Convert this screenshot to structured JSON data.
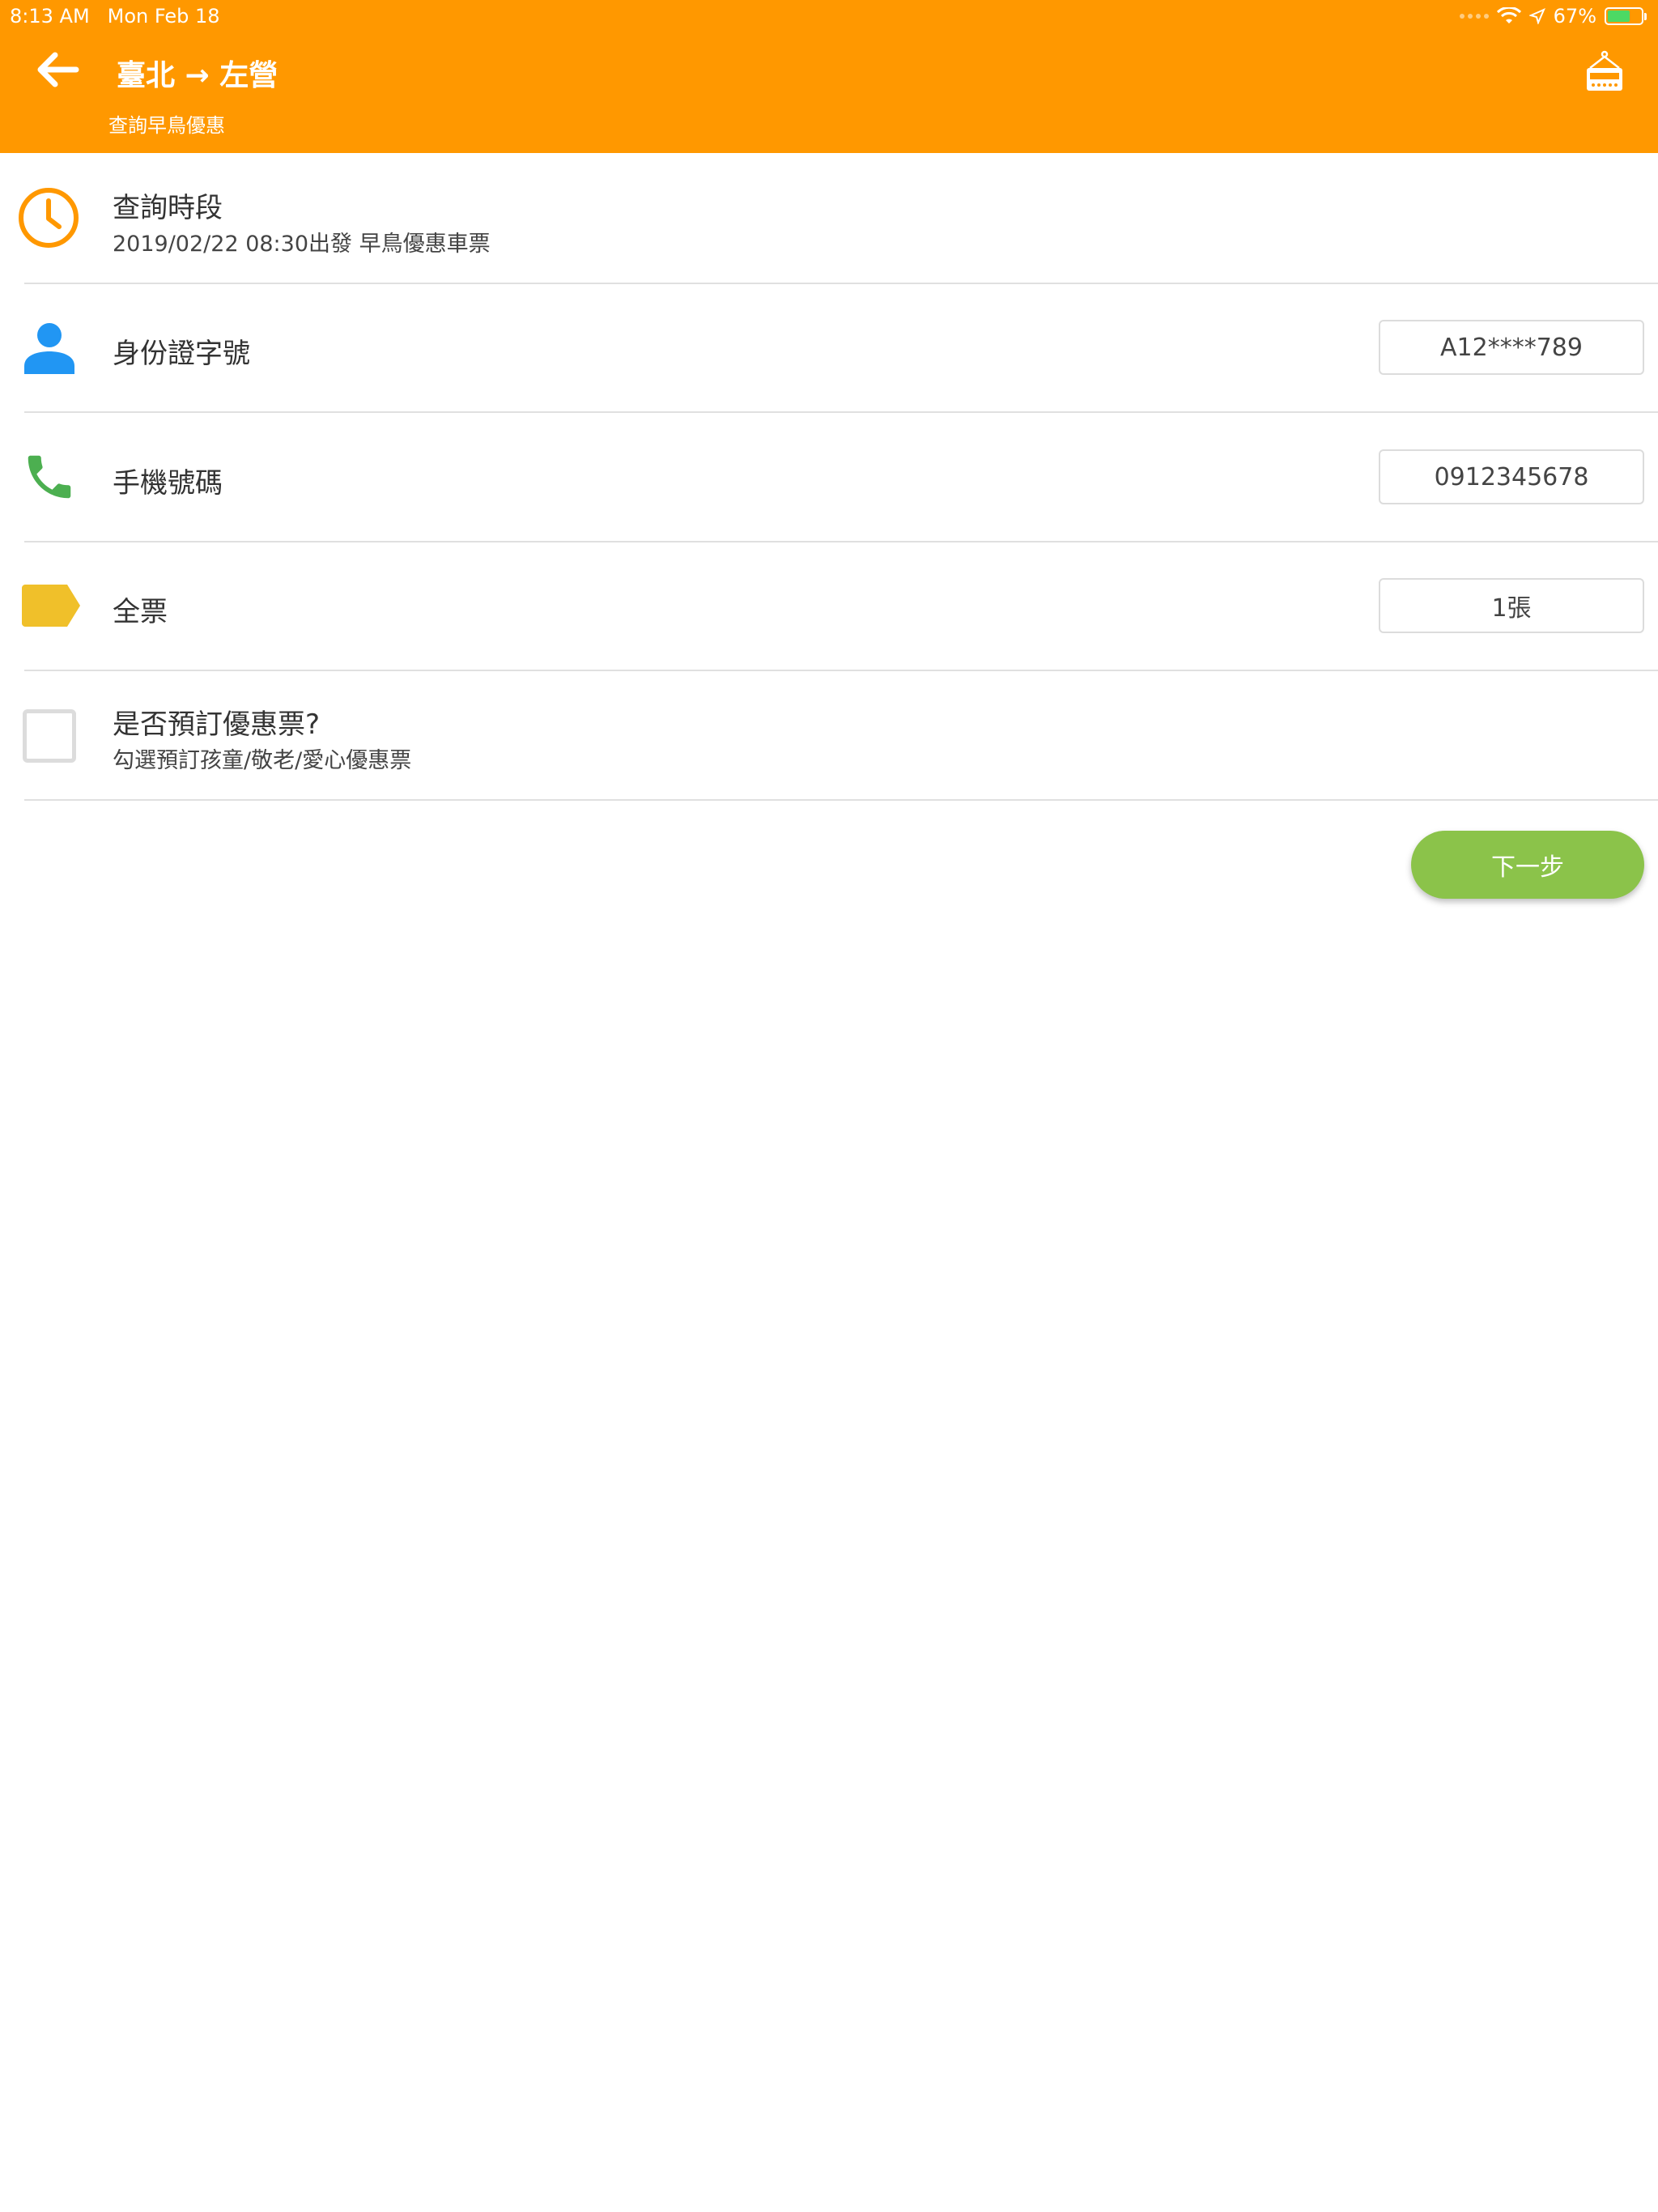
{
  "status_bar": {
    "time": "8:13 AM",
    "date": "Mon Feb 18",
    "battery": "67%"
  },
  "header": {
    "title": "臺北 → 左營",
    "subtitle": "查詢早鳥優惠",
    "back_icon": "arrow-left-icon",
    "hotel_icon": "hotel-sign-icon",
    "background_color": "#FF9800"
  },
  "rows": {
    "time_slot": {
      "title": "查詢時段",
      "detail": "2019/02/22 08:30出發 早鳥優惠車票",
      "icon": "clock-icon",
      "icon_color": "#FF9800"
    },
    "id_number": {
      "label": "身份證字號",
      "value": "A12****789",
      "icon": "person-icon",
      "icon_color": "#2196F3"
    },
    "phone": {
      "label": "手機號碼",
      "value": "0912345678",
      "icon": "phone-icon",
      "icon_color": "#4CAF50"
    },
    "full_ticket": {
      "label": "全票",
      "value": "1張",
      "icon": "tag-icon",
      "icon_color": "#F0C02A"
    },
    "discount": {
      "title": "是否預訂優惠票?",
      "detail": "勾選預訂孩童/敬老/愛心優惠票",
      "checked": false
    }
  },
  "next_button": {
    "label": "下一步",
    "color": "#8BC34A"
  }
}
